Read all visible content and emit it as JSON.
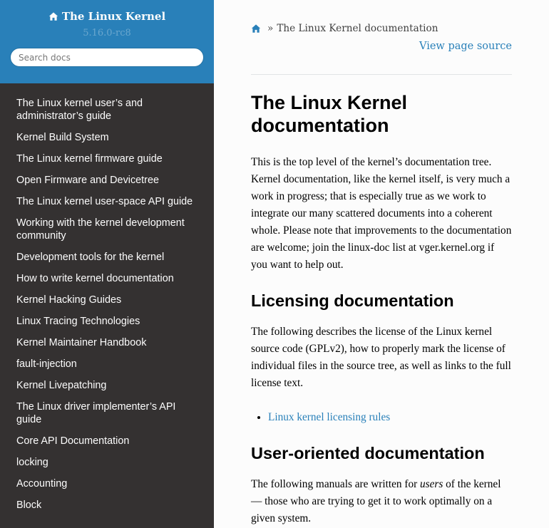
{
  "sidebar": {
    "project_title": "The Linux Kernel",
    "version": "5.16.0-rc8",
    "search_placeholder": "Search docs",
    "items": [
      {
        "label": "The Linux kernel user’s and administrator’s guide"
      },
      {
        "label": "Kernel Build System"
      },
      {
        "label": "The Linux kernel firmware guide"
      },
      {
        "label": "Open Firmware and Devicetree"
      },
      {
        "label": "The Linux kernel user-space API guide"
      },
      {
        "label": "Working with the kernel development community"
      },
      {
        "label": "Development tools for the kernel"
      },
      {
        "label": "How to write kernel documentation"
      },
      {
        "label": "Kernel Hacking Guides"
      },
      {
        "label": "Linux Tracing Technologies"
      },
      {
        "label": "Kernel Maintainer Handbook"
      },
      {
        "label": "fault-injection"
      },
      {
        "label": "Kernel Livepatching"
      },
      {
        "label": "The Linux driver implementer’s API guide"
      },
      {
        "label": "Core API Documentation"
      },
      {
        "label": "locking"
      },
      {
        "label": "Accounting"
      },
      {
        "label": "Block"
      }
    ]
  },
  "breadcrumb": {
    "separator": "»",
    "current": "The Linux Kernel documentation",
    "view_source": "View page source"
  },
  "content": {
    "title": "The Linux Kernel documentation",
    "intro": "This is the top level of the kernel’s documentation tree. Kernel documentation, like the kernel itself, is very much a work in progress; that is especially true as we work to integrate our many scattered documents into a coherent whole. Please note that improvements to the documentation are welcome; join the linux-doc list at vger.kernel.org if you want to help out.",
    "licensing": {
      "heading": "Licensing documentation",
      "text": "The following describes the license of the Linux kernel source code (GPLv2), how to properly mark the license of individual files in the source tree, as well as links to the full license text.",
      "link": "Linux kernel licensing rules"
    },
    "user": {
      "heading": "User-oriented documentation",
      "text_before": "The following manuals are written for ",
      "text_em": "users",
      "text_after": " of the kernel — those who are trying to get it to work optimally on a given system."
    }
  },
  "colors": {
    "sidebar_bg": "#343131",
    "sidebar_header_bg": "#2980b9",
    "link": "#2980b9",
    "content_bg": "#fcfcfc"
  },
  "icons": {
    "home": "home-icon"
  }
}
